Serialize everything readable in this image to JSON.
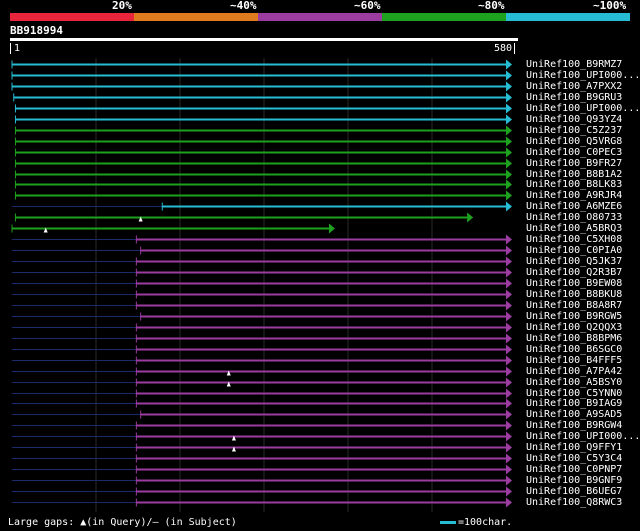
{
  "legend": {
    "labels": [
      "20%",
      "~40%",
      "~60%",
      "~80%",
      "~100%"
    ],
    "colors": [
      "#e8253a",
      "#e07a1f",
      "#9c3ba0",
      "#1ea11e",
      "#26bcd4"
    ]
  },
  "query": {
    "id": "BB918994",
    "start": "1",
    "end": "580"
  },
  "hits": [
    {
      "name": "UniRef100_B9RMZ7",
      "color": "cyan",
      "qs": 1,
      "qe": 580
    },
    {
      "name": "UniRef100_UPI000...",
      "color": "cyan",
      "qs": 1,
      "qe": 580
    },
    {
      "name": "UniRef100_A7PXX2",
      "color": "cyan",
      "qs": 1,
      "qe": 580
    },
    {
      "name": "UniRef100_B9GRU3",
      "color": "cyan",
      "qs": 3,
      "qe": 580
    },
    {
      "name": "UniRef100_UPI000...",
      "color": "cyan",
      "qs": 5,
      "qe": 580
    },
    {
      "name": "UniRef100_Q93YZ4",
      "color": "cyan",
      "qs": 5,
      "qe": 580
    },
    {
      "name": "UniRef100_C5Z237",
      "color": "green",
      "qs": 5,
      "qe": 580
    },
    {
      "name": "UniRef100_Q5VRG8",
      "color": "green",
      "qs": 5,
      "qe": 580
    },
    {
      "name": "UniRef100_C0PEC3",
      "color": "green",
      "qs": 5,
      "qe": 580
    },
    {
      "name": "UniRef100_B9FR27",
      "color": "green",
      "qs": 5,
      "qe": 580
    },
    {
      "name": "UniRef100_B8B1A2",
      "color": "green",
      "qs": 5,
      "qe": 580
    },
    {
      "name": "UniRef100_B8LK83",
      "color": "green",
      "qs": 5,
      "qe": 580
    },
    {
      "name": "UniRef100_A9RJR4",
      "color": "green",
      "qs": 5,
      "qe": 580
    },
    {
      "name": "UniRef100_A6MZE6",
      "color": "cyan",
      "qs": 175,
      "qe": 580
    },
    {
      "name": "UniRef100_O80733",
      "color": "green",
      "qs": 5,
      "qe": 535,
      "gap": 150
    },
    {
      "name": "UniRef100_A5BRQ3",
      "color": "green",
      "qs": 1,
      "qe": 375,
      "gap": 40
    },
    {
      "name": "UniRef100_C5XH08",
      "color": "purple",
      "qs": 145,
      "qe": 580
    },
    {
      "name": "UniRef100_C0PIA0",
      "color": "purple",
      "qs": 150,
      "qe": 580
    },
    {
      "name": "UniRef100_Q5JK37",
      "color": "purple",
      "qs": 145,
      "qe": 580
    },
    {
      "name": "UniRef100_Q2R3B7",
      "color": "purple",
      "qs": 145,
      "qe": 580
    },
    {
      "name": "UniRef100_B9EW08",
      "color": "purple",
      "qs": 145,
      "qe": 580
    },
    {
      "name": "UniRef100_B8BKU8",
      "color": "purple",
      "qs": 145,
      "qe": 580
    },
    {
      "name": "UniRef100_B8A8R7",
      "color": "purple",
      "qs": 145,
      "qe": 580
    },
    {
      "name": "UniRef100_B9RGW5",
      "color": "purple",
      "qs": 150,
      "qe": 580
    },
    {
      "name": "UniRef100_Q2QQX3",
      "color": "purple",
      "qs": 145,
      "qe": 580
    },
    {
      "name": "UniRef100_B8BPM6",
      "color": "purple",
      "qs": 145,
      "qe": 580
    },
    {
      "name": "UniRef100_B6SGC0",
      "color": "purple",
      "qs": 145,
      "qe": 580
    },
    {
      "name": "UniRef100_B4FFF5",
      "color": "purple",
      "qs": 145,
      "qe": 580
    },
    {
      "name": "UniRef100_A7PA42",
      "color": "purple",
      "qs": 145,
      "qe": 580,
      "gap": 252
    },
    {
      "name": "UniRef100_A5BSY0",
      "color": "purple",
      "qs": 145,
      "qe": 580,
      "gap": 252
    },
    {
      "name": "UniRef100_C5YNN0",
      "color": "purple",
      "qs": 145,
      "qe": 580
    },
    {
      "name": "UniRef100_B9IAG9",
      "color": "purple",
      "qs": 145,
      "qe": 580
    },
    {
      "name": "UniRef100_A9SAD5",
      "color": "purple",
      "qs": 150,
      "qe": 580
    },
    {
      "name": "UniRef100_B9RGW4",
      "color": "purple",
      "qs": 145,
      "qe": 580
    },
    {
      "name": "UniRef100_UPI000...",
      "color": "purple",
      "qs": 145,
      "qe": 580,
      "gap": 258
    },
    {
      "name": "UniRef100_Q9FFY1",
      "color": "purple",
      "qs": 145,
      "qe": 580,
      "gap": 258
    },
    {
      "name": "UniRef100_C5Y3C4",
      "color": "purple",
      "qs": 145,
      "qe": 580
    },
    {
      "name": "UniRef100_C0PNP7",
      "color": "purple",
      "qs": 145,
      "qe": 580
    },
    {
      "name": "UniRef100_B9GNF9",
      "color": "purple",
      "qs": 145,
      "qe": 580
    },
    {
      "name": "UniRef100_B6UEG7",
      "color": "purple",
      "qs": 145,
      "qe": 580
    },
    {
      "name": "UniRef100_Q8RWC3",
      "color": "purple",
      "qs": 145,
      "qe": 580
    }
  ],
  "footer": {
    "gaps_label": "Large gaps: ▲(in Query)/– (in Subject)",
    "scale_label": "=100char."
  }
}
